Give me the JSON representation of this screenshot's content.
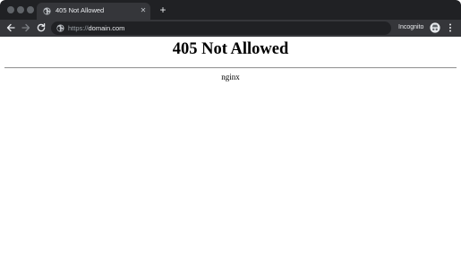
{
  "browser": {
    "tab": {
      "title": "405 Not Allowed",
      "close_glyph": "✕",
      "favicon_icon": "globe-icon"
    },
    "new_tab_glyph": "+",
    "toolbar": {
      "url_scheme": "https://",
      "url_host": "domain.com",
      "incognito_label": "Incognito"
    },
    "colors": {
      "tabstrip": "#202124",
      "toolbar": "#35363a",
      "omnibox": "#202124",
      "text": "#e8eaed"
    }
  },
  "page": {
    "heading": "405 Not Allowed",
    "server": "nginx"
  }
}
